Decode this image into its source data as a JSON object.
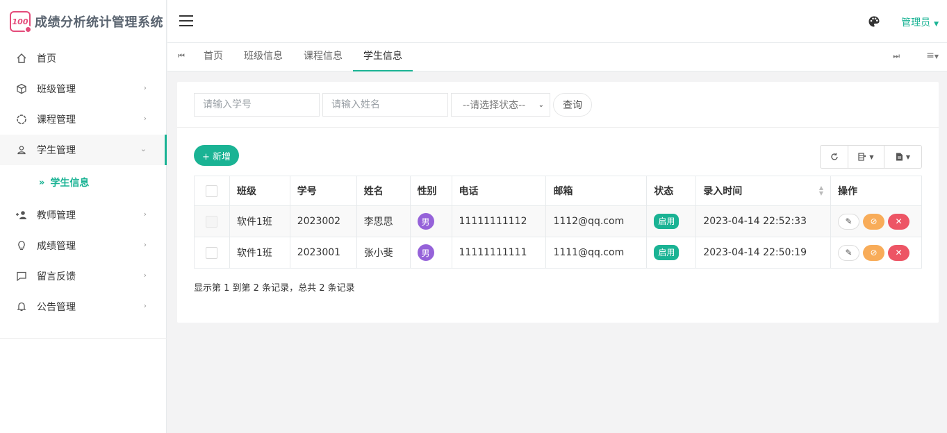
{
  "app": {
    "title": "成绩分析统计管理系统",
    "logo_text": "100"
  },
  "sidebar": {
    "items": [
      {
        "label": "首页",
        "icon": "home-icon",
        "has_arrow": false
      },
      {
        "label": "班级管理",
        "icon": "cube-icon",
        "has_arrow": true
      },
      {
        "label": "课程管理",
        "icon": "circle-notch-icon",
        "has_arrow": true
      },
      {
        "label": "学生管理",
        "icon": "user-icon",
        "has_arrow": true,
        "expanded": true
      },
      {
        "label": "教师管理",
        "icon": "user-plus-icon",
        "has_arrow": true
      },
      {
        "label": "成绩管理",
        "icon": "lightbulb-icon",
        "has_arrow": true
      },
      {
        "label": "留言反馈",
        "icon": "comment-icon",
        "has_arrow": true
      },
      {
        "label": "公告管理",
        "icon": "bell-icon",
        "has_arrow": true
      }
    ],
    "sub_item": "学生信息"
  },
  "header": {
    "user": "管理员"
  },
  "tabs": {
    "items": [
      "首页",
      "班级信息",
      "课程信息",
      "学生信息"
    ],
    "active": "学生信息"
  },
  "search": {
    "student_no_placeholder": "请输入学号",
    "name_placeholder": "请输入姓名",
    "status_select": "--请选择状态--",
    "query_label": "查询"
  },
  "toolbar": {
    "add_label": "+ 新增"
  },
  "table": {
    "columns": [
      "班级",
      "学号",
      "姓名",
      "性别",
      "电话",
      "邮箱",
      "状态",
      "录入时间",
      "操作"
    ],
    "rows": [
      {
        "class": "软件1班",
        "student_no": "2023002",
        "name": "李思思",
        "sex": "男",
        "phone": "11111111112",
        "email": "1112@qq.com",
        "status": "启用",
        "created": "2023-04-14 22:52:33"
      },
      {
        "class": "软件1班",
        "student_no": "2023001",
        "name": "张小斐",
        "sex": "男",
        "phone": "11111111111",
        "email": "1111@qq.com",
        "status": "启用",
        "created": "2023-04-14 22:50:19"
      }
    ]
  },
  "pagination": {
    "summary": "显示第 1 到第 2 条记录，总共 2 条记录"
  },
  "colors": {
    "accent": "#1ab394",
    "sex_badge": "#9562d9",
    "disable": "#f8ac59",
    "delete": "#ed5565",
    "logo": "#e44b7a"
  }
}
